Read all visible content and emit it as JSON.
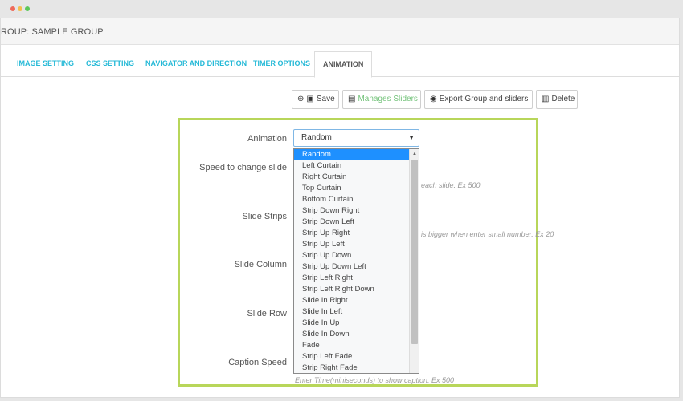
{
  "group_header": {
    "title": "ROUP: SAMPLE GROUP"
  },
  "tabs": [
    {
      "label": "IMAGE SETTING"
    },
    {
      "label": "CSS SETTING"
    },
    {
      "label": "NAVIGATOR AND DIRECTION"
    },
    {
      "label": "TIMER OPTIONS"
    },
    {
      "label": "ANIMATION",
      "active": true
    }
  ],
  "toolbar": {
    "save": {
      "label": "Save",
      "icon": "plus-circle-icon"
    },
    "manage": {
      "label": "Manages Sliders",
      "icon": "film-icon"
    },
    "export": {
      "label": "Export Group and sliders",
      "icon": "eye-icon"
    },
    "delete": {
      "label": "Delete",
      "icon": "trash-icon"
    }
  },
  "form": {
    "animation_label": "Animation",
    "speed_label": "Speed to change slide",
    "speed_help": "each slide. Ex 500",
    "strips_label": "Slide Strips",
    "strips_help": "is bigger when enter small number. Ex 20",
    "column_label": "Slide Column",
    "row_label": "Slide Row",
    "caption_label": "Caption Speed",
    "caption_help": "Enter Time(miniseconds) to show caption. Ex 500"
  },
  "select": {
    "value": "Random",
    "options": [
      "Random",
      "Left Curtain",
      "Right Curtain",
      "Top Curtain",
      "Bottom Curtain",
      "Strip Down Right",
      "Strip Down Left",
      "Strip Up Right",
      "Strip Up Left",
      "Strip Up Down",
      "Strip Up Down Left",
      "Strip Left Right",
      "Strip Left Right Down",
      "Slide In Right",
      "Slide In Left",
      "Slide In Up",
      "Slide In Down",
      "Fade",
      "Strip Left Fade",
      "Strip Right Fade"
    ]
  },
  "colors": {
    "tab_link": "#25b9d7",
    "highlight": "#b8d65a",
    "selected_option": "#1e90ff"
  }
}
